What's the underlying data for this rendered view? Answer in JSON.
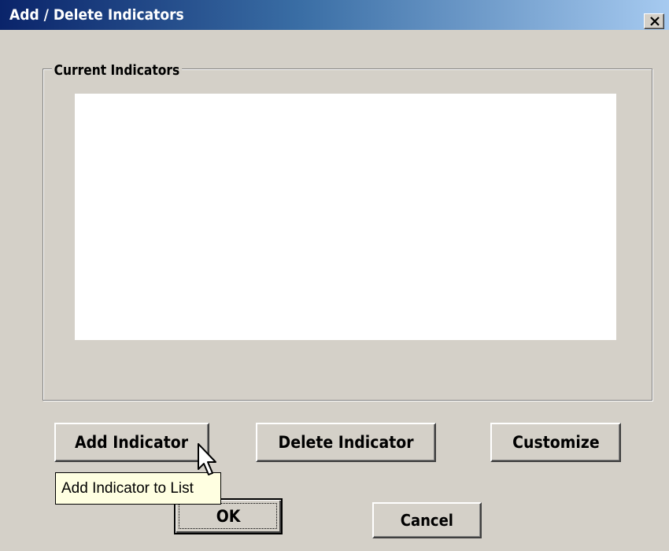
{
  "window": {
    "title": "Add / Delete Indicators",
    "close_glyph": "✕"
  },
  "group": {
    "label": "Current Indicators",
    "items": []
  },
  "buttons": {
    "add_indicator": "Add Indicator",
    "delete_indicator": "Delete Indicator",
    "customize": "Customize",
    "ok": "OK",
    "cancel": "Cancel"
  },
  "tooltip": {
    "text": "Add Indicator to List"
  },
  "icons": {
    "close": "close-icon",
    "cursor": "mouse-pointer-icon"
  },
  "colors": {
    "titlebar_start": "#0a246a",
    "titlebar_end": "#a6caf0",
    "dialog_face": "#d4d0c8",
    "list_background": "#ffffff",
    "tooltip_background": "#ffffe1"
  }
}
